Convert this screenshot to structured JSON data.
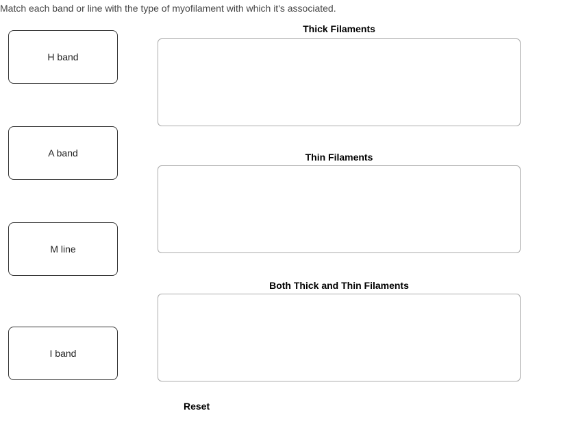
{
  "instruction": "Match each band or line with the type of myofilament with which it's associated.",
  "draggables": {
    "card1": "H band",
    "card2": "A band",
    "card3": "M line",
    "card4": "I band"
  },
  "dropzones": {
    "title1": "Thick Filaments",
    "title2": "Thin Filaments",
    "title3": "Both Thick and Thin Filaments"
  },
  "controls": {
    "reset": "Reset"
  }
}
